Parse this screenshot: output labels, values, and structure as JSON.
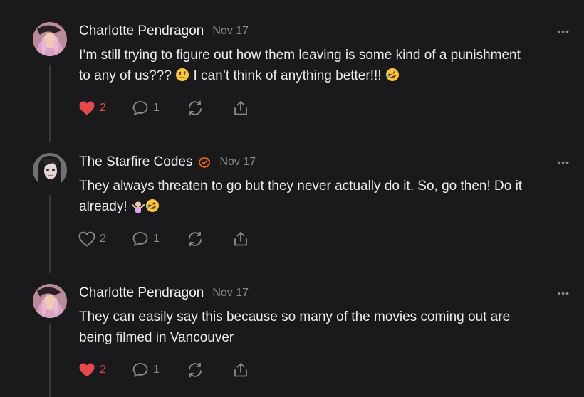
{
  "comments": [
    {
      "author": "Charlotte Pendragon",
      "verified": false,
      "date": "Nov 17",
      "more": "•••",
      "line1": "I’m still trying to figure out how them leaving is some kind of a punishment",
      "line2a": "to any of us???",
      "line2b": "I can’t think of anything better!!!",
      "emojis": [
        "face-with-raised-eyebrow",
        "rolling-on-floor-laughing"
      ],
      "likes": "2",
      "liked": true,
      "replies": "1"
    },
    {
      "author": "The Starfire Codes",
      "verified": true,
      "date": "Nov 17",
      "more": "•••",
      "line1": "They always threaten to go but they never actually do it. So, go then! Do it",
      "line2a": "already!",
      "emojis": [
        "person-shrugging",
        "rolling-on-floor-laughing"
      ],
      "likes": "2",
      "liked": false,
      "replies": "1"
    },
    {
      "author": "Charlotte Pendragon",
      "verified": false,
      "date": "Nov 17",
      "more": "•••",
      "line1": "They can easily say this because so many of the movies coming out are",
      "line2a": "being filmed in Vancouver",
      "likes": "2",
      "liked": true,
      "replies": "1"
    }
  ],
  "colors": {
    "background": "#1a1a1c",
    "like_active": "#e5484d",
    "muted": "#8b8b90",
    "verified": "#ff6719"
  },
  "icons": [
    "heart-icon",
    "comment-icon",
    "restack-icon",
    "share-icon",
    "verified-badge-icon",
    "more-icon"
  ]
}
